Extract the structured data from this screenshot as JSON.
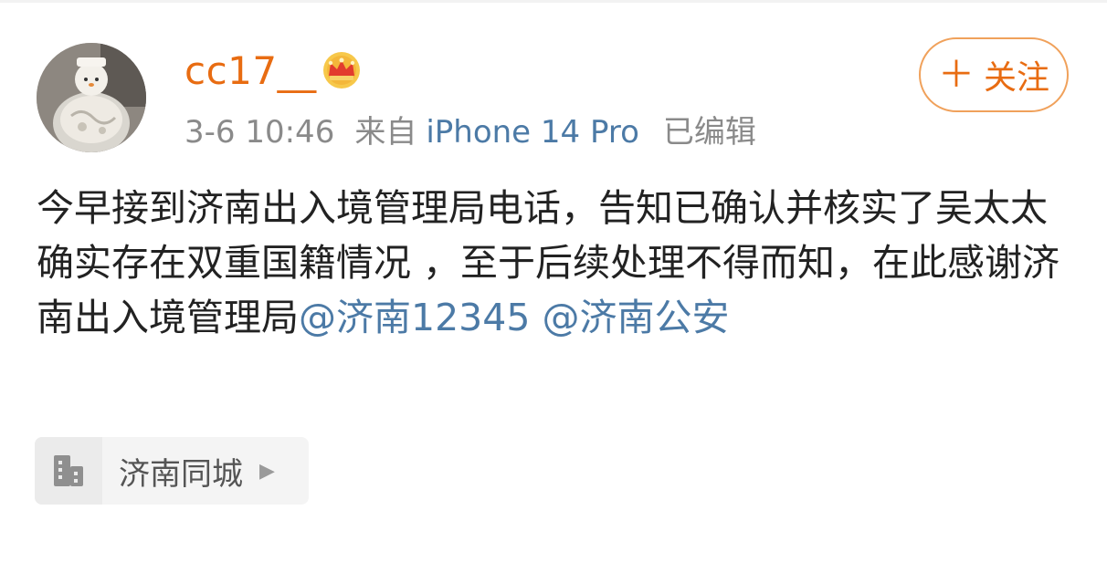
{
  "post": {
    "username": "cc17__",
    "time": "3-6 10:46",
    "source_prefix": "来自",
    "device": "iPhone 14 Pro",
    "edited": "已编辑",
    "follow_label": "关注",
    "follow_plus": "＋",
    "content_text": "今早接到济南出入境管理局电话，告知已确认并核实了吴太太确实存在双重国籍情况 ，至于后续处理不得而知，在此感谢济南出入境管理局",
    "mentions": [
      "@济南12345",
      "@济南公安"
    ],
    "location": "济南同城"
  },
  "colors": {
    "username": "#e86c12",
    "link": "#4c7aa6",
    "meta": "#8a8a8a"
  },
  "icons": [
    "avatar-image",
    "vip-crown-icon",
    "building-icon",
    "chevron-right-icon"
  ]
}
